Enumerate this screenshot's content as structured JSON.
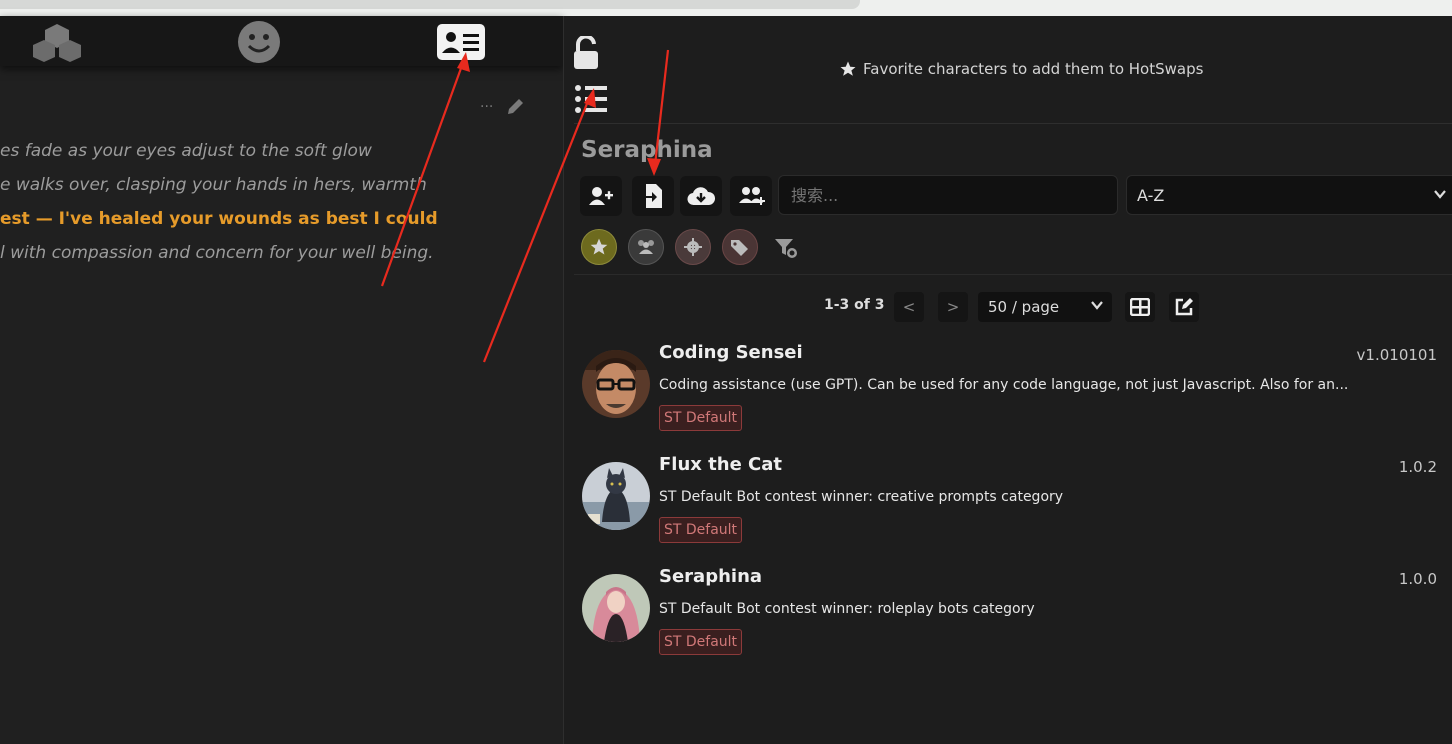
{
  "colors": {
    "accent_orange": "#e69b2a",
    "arrow_red": "#e82a1e",
    "tag_red": "#8c3a3a"
  },
  "left_tabs": [
    {
      "icon": "cubes-icon"
    },
    {
      "icon": "smiley-icon"
    },
    {
      "icon": "id-card-icon"
    }
  ],
  "chat": {
    "lines": [
      {
        "text": "es fade as your eyes adjust to the soft glow",
        "style": "narration"
      },
      {
        "text": "e walks over, clasping your hands in hers, warmth",
        "style": "narration"
      },
      {
        "text": "est — I've healed your wounds as best I could",
        "style": "quote"
      },
      {
        "text": "l with compassion and concern for your well being.",
        "style": "narration"
      }
    ],
    "tools_label": "···"
  },
  "right": {
    "hotswap_text": "Favorite characters to add them to HotSwaps",
    "character_name": "Seraphina",
    "toolbar": [
      {
        "icon": "add-user-icon"
      },
      {
        "icon": "import-file-icon"
      },
      {
        "icon": "cloud-download-icon"
      },
      {
        "icon": "group-add-icon"
      }
    ],
    "search": {
      "placeholder": "搜索..."
    },
    "sort": {
      "value": "A-Z"
    },
    "tag_filters": [
      {
        "icon": "star-icon"
      },
      {
        "icon": "users-icon"
      },
      {
        "icon": "gear-icon"
      },
      {
        "icon": "tags-icon"
      }
    ],
    "pagination": {
      "range_text": "1-3 of 3",
      "prev_label": "<",
      "next_label": ">",
      "per_page": "50 / page"
    },
    "characters": [
      {
        "name": "Coding Sensei",
        "version": "v1.010101",
        "description": "Coding assistance (use GPT). Can be used for any code language, not just Javascript. Also for an...",
        "tag": "ST Default"
      },
      {
        "name": "Flux the Cat",
        "version": "1.0.2",
        "description": "ST Default Bot contest winner: creative prompts category",
        "tag": "ST Default"
      },
      {
        "name": "Seraphina",
        "version": "1.0.0",
        "description": "ST Default Bot contest winner: roleplay bots category",
        "tag": "ST Default"
      }
    ]
  }
}
